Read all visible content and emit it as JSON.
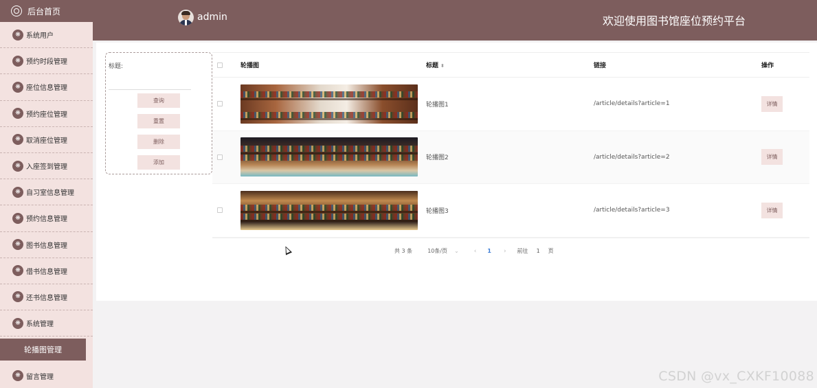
{
  "sidebar": {
    "home_label": "后台首页",
    "items": [
      {
        "label": "系统用户",
        "icon": "menu-icon"
      },
      {
        "label": "预约时段管理",
        "icon": "menu-icon"
      },
      {
        "label": "座位信息管理",
        "icon": "menu-icon"
      },
      {
        "label": "预约座位管理",
        "icon": "menu-icon"
      },
      {
        "label": "取消座位管理",
        "icon": "menu-icon"
      },
      {
        "label": "入座签到管理",
        "icon": "menu-icon"
      },
      {
        "label": "自习室信息管理",
        "icon": "menu-icon"
      },
      {
        "label": "预约信息管理",
        "icon": "menu-icon"
      },
      {
        "label": "图书信息管理",
        "icon": "menu-icon"
      },
      {
        "label": "借书信息管理",
        "icon": "menu-icon"
      },
      {
        "label": "还书信息管理",
        "icon": "menu-icon"
      },
      {
        "label": "系统管理",
        "icon": "menu-icon"
      },
      {
        "label": "轮播图管理",
        "active": true
      },
      {
        "label": "留言管理",
        "icon": "menu-icon"
      }
    ]
  },
  "header": {
    "username": "admin",
    "welcome": "欢迎使用图书馆座位预约平台"
  },
  "search": {
    "title_label": "标题:",
    "title_value": "",
    "buttons": {
      "query": "查询",
      "reset": "重置",
      "delete": "删除",
      "add": "添加"
    }
  },
  "table": {
    "headers": {
      "image": "轮播图",
      "title": "标题",
      "link": "链接",
      "action": "操作"
    },
    "rows": [
      {
        "title": "轮播图1",
        "link": "/article/details?article=1",
        "action": "详情"
      },
      {
        "title": "轮播图2",
        "link": "/article/details?article=2",
        "action": "详情"
      },
      {
        "title": "轮播图3",
        "link": "/article/details?article=3",
        "action": "详情"
      }
    ]
  },
  "pagination": {
    "total": "共 3 条",
    "page_size": "10条/页",
    "current_page": "1",
    "goto_prefix": "前往",
    "goto_value": "1",
    "goto_suffix": "页"
  },
  "watermark": "CSDN @vx_CXKF10088",
  "colors": {
    "primary": "#7d5d5d",
    "sidebar_bg": "#f3e2e0",
    "accent_link": "#3a7bd5"
  }
}
